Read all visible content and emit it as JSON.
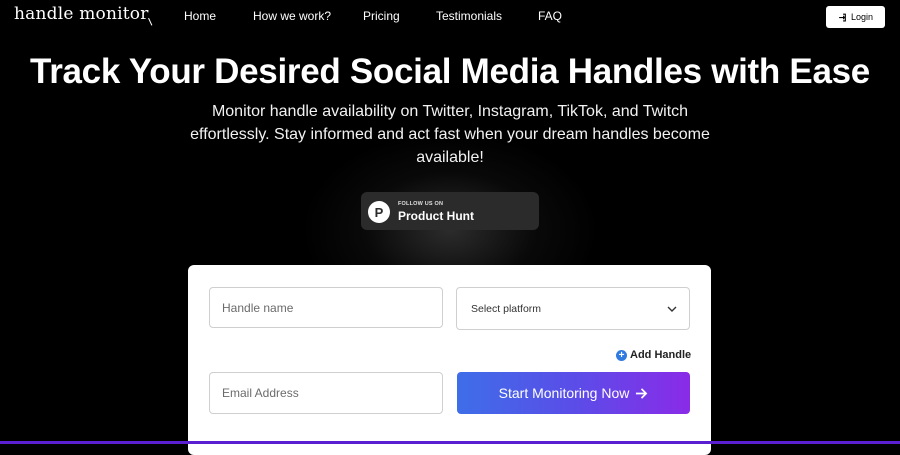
{
  "header": {
    "logo": "handle monitor",
    "nav": [
      "Home",
      "How we work?",
      "Pricing",
      "Testimonials",
      "FAQ"
    ],
    "login_label": "Login"
  },
  "hero": {
    "title": "Track Your Desired Social Media Handles with Ease",
    "subtitle": "Monitor handle availability on Twitter, Instagram, TikTok, and Twitch effortlessly. Stay informed and act fast when your dream handles become available!"
  },
  "product_hunt": {
    "small": "FOLLOW US ON",
    "big": "Product Hunt",
    "letter": "P"
  },
  "form": {
    "handle_placeholder": "Handle name",
    "platform_selected": "Select platform",
    "add_handle_label": "Add Handle",
    "email_placeholder": "Email Address",
    "start_label": "Start Monitoring Now"
  },
  "colors": {
    "background": "#000000",
    "accent_start": "#3e6ee8",
    "accent_end": "#8a2be8",
    "add_icon": "#2f7be0"
  },
  "icons": {
    "login": "login-icon",
    "chevron": "chevron-down-icon",
    "add": "plus-circle-icon",
    "arrow": "arrow-right-icon"
  }
}
